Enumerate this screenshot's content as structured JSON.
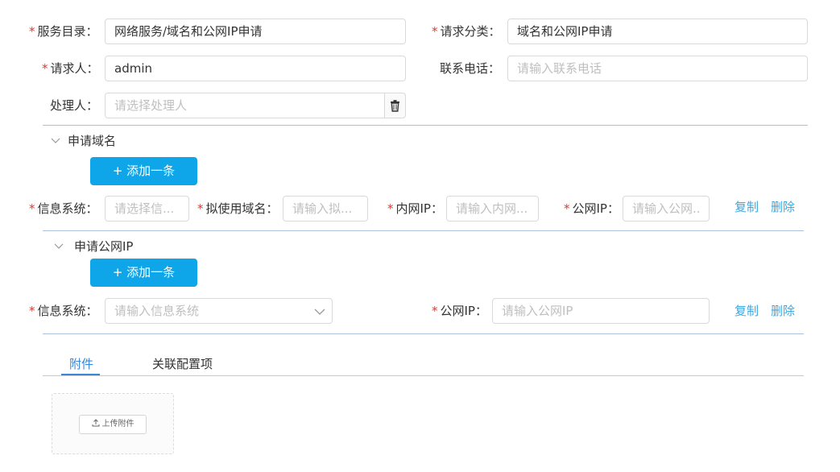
{
  "form": {
    "service_catalog": {
      "label": "服务目录",
      "value": "网络服务/域名和公网IP申请"
    },
    "request_category": {
      "label": "请求分类",
      "value": "域名和公网IP申请"
    },
    "requester": {
      "label": "请求人",
      "value": "admin"
    },
    "phone": {
      "label": "联系电话",
      "placeholder": "请输入联系电话"
    },
    "handler": {
      "label": "处理人",
      "placeholder": "请选择处理人"
    },
    "colon": "：",
    "required_mark": "*"
  },
  "domain_section": {
    "title": "申请域名",
    "add_label": "+ 添加一条",
    "row": {
      "info_system": {
        "label": "信息系统",
        "placeholder": "请选择信..."
      },
      "domain": {
        "label": "拟使用域名",
        "placeholder": "请输入拟..."
      },
      "intranet_ip": {
        "label": "内网IP",
        "placeholder": "请输入内网..."
      },
      "public_ip": {
        "label": "公网IP",
        "placeholder": "请输入公网.."
      },
      "copy_label": "复制",
      "delete_label": "删除"
    }
  },
  "ip_section": {
    "title": "申请公网IP",
    "add_label": "+ 添加一条",
    "row": {
      "info_system": {
        "label": "信息系统",
        "placeholder": "请输入信息系统"
      },
      "public_ip": {
        "label": "公网IP",
        "placeholder": "请输入公网IP"
      },
      "copy_label": "复制",
      "delete_label": "删除"
    }
  },
  "tabs": [
    {
      "label": "附件",
      "active": true
    },
    {
      "label": "关联配置项",
      "active": false
    }
  ],
  "upload": {
    "label": "上传附件"
  },
  "icons": {
    "trash": "trash-icon",
    "chevron_down": "chevron-down-icon",
    "upload": "upload-icon"
  },
  "colors": {
    "required": "#e8342c",
    "primary": "#0ea5e9",
    "link": "#3aa8e0",
    "tab_active": "#3a87d6",
    "divider": "#a9c1de"
  }
}
